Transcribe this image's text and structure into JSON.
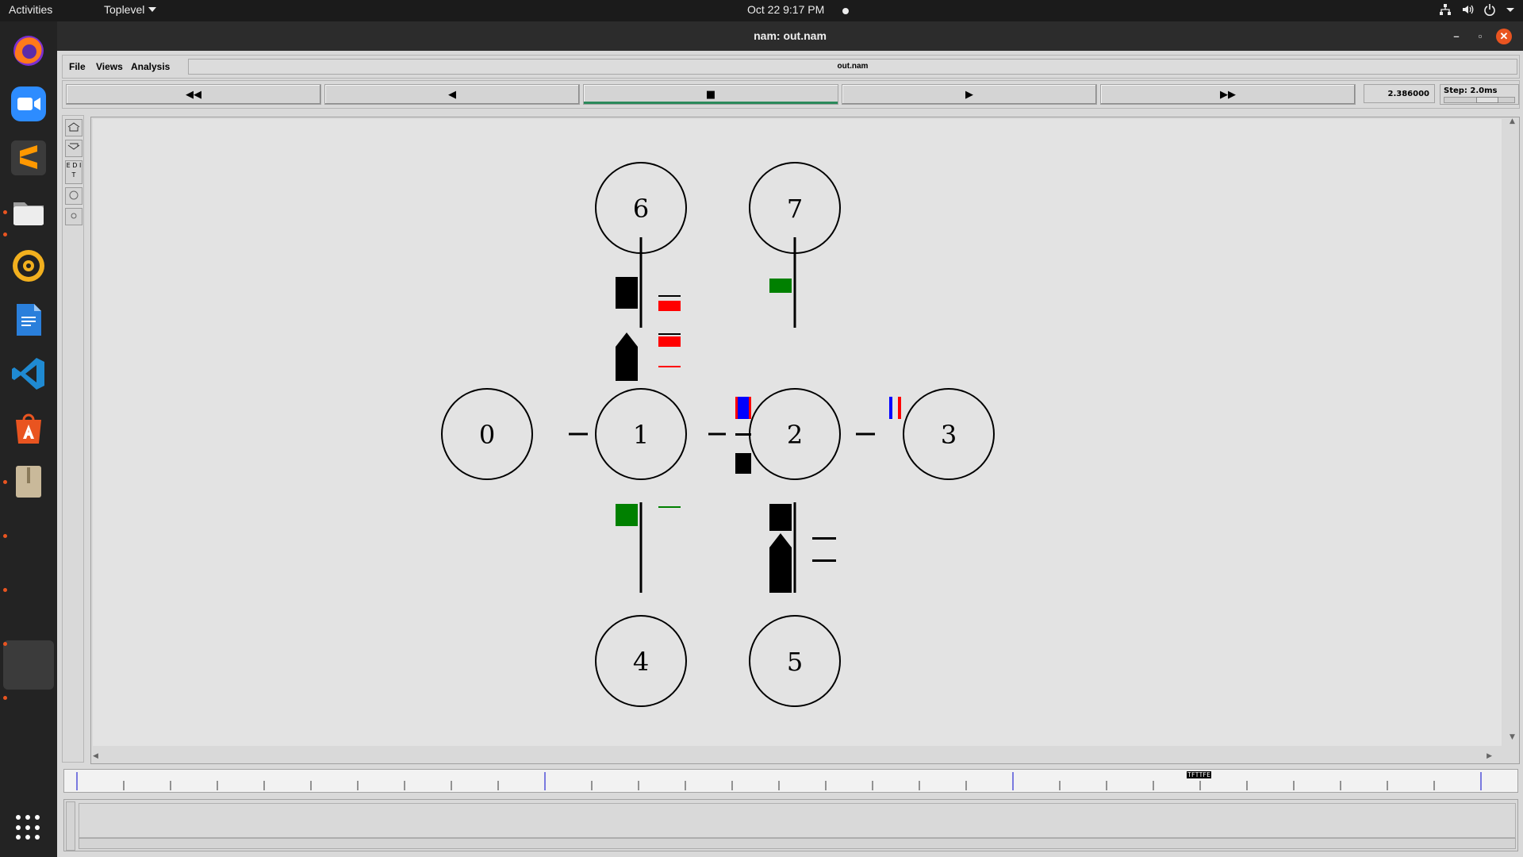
{
  "topbar": {
    "activities": "Activities",
    "toplevel": "Toplevel",
    "clock": "Oct 22  9:17 PM"
  },
  "dock": {
    "apps": [
      "firefox-icon",
      "zoom-icon",
      "sublime-text-icon",
      "files-icon",
      "rhythmbox-icon",
      "writer-icon",
      "vscode-icon",
      "app-center-icon",
      "archive-manager-icon"
    ],
    "show_apps": "show-applications-icon"
  },
  "window": {
    "title": "nam: out.nam",
    "menus": [
      "File",
      "Views",
      "Analysis"
    ],
    "filename": "out.nam",
    "controls": {
      "rewind": "◀◀",
      "back": "◀",
      "stop": "■",
      "play": "▶",
      "fast_forward": "▶▶"
    },
    "time": "2.386000",
    "step": "Step: 2.0ms",
    "tools": [
      "E D I T"
    ],
    "timeline_marker": "TFTTFE"
  },
  "network": {
    "nodes": [
      {
        "id": "0"
      },
      {
        "id": "1"
      },
      {
        "id": "2"
      },
      {
        "id": "3"
      },
      {
        "id": "4"
      },
      {
        "id": "5"
      },
      {
        "id": "6"
      },
      {
        "id": "7"
      }
    ],
    "colors": {
      "red": "#ff0000",
      "green": "#008000",
      "blue": "#0000ff",
      "black": "#000000"
    }
  }
}
